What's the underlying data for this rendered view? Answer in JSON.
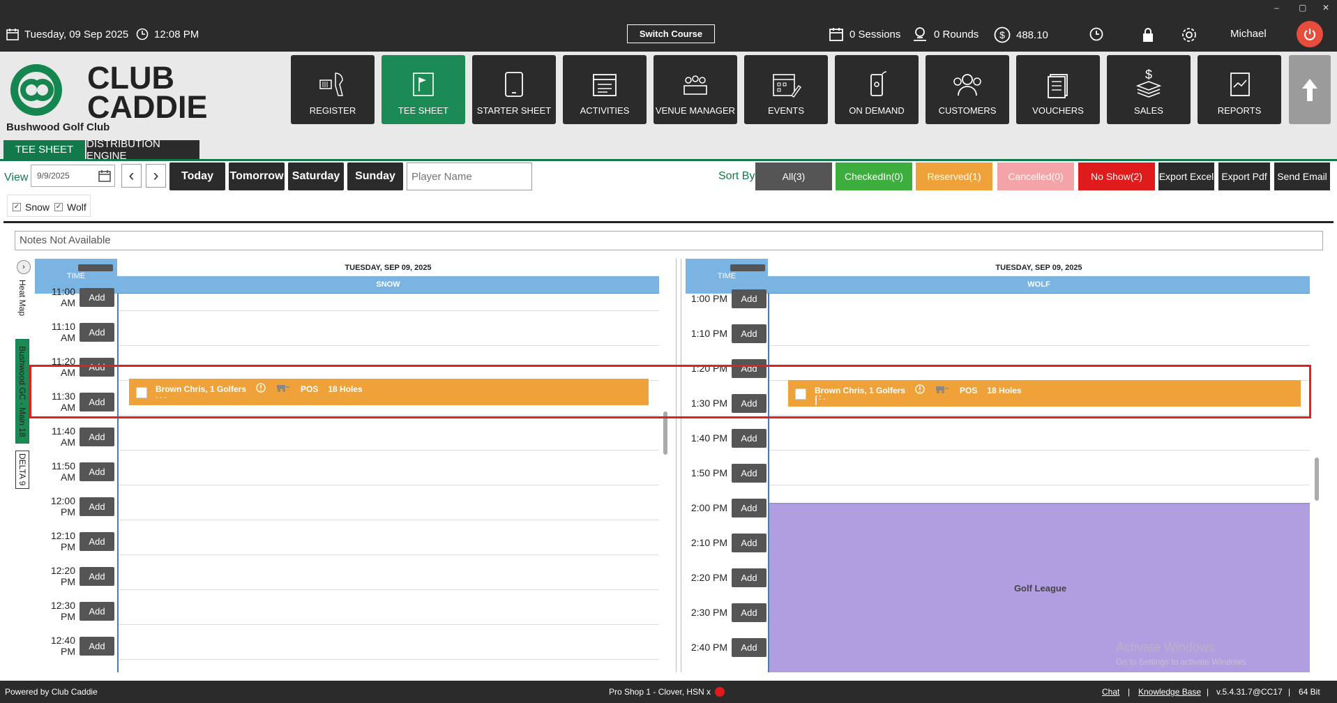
{
  "topbar": {
    "date": "Tuesday,  09 Sep 2025",
    "time": "12:08 PM",
    "switch_course": "Switch Course",
    "sessions": "0 Sessions",
    "rounds": "0 Rounds",
    "balance": "488.10",
    "user": "Michael",
    "win_controls": [
      "–",
      "▢",
      "✕"
    ]
  },
  "brand": {
    "line1": "CLUB",
    "line2": "CADDIE",
    "club_name": "Bushwood Golf Club"
  },
  "nav": [
    {
      "label": "REGISTER",
      "icon": "scanner-icon"
    },
    {
      "label": "TEE SHEET",
      "icon": "flag-icon"
    },
    {
      "label": "STARTER SHEET",
      "icon": "tablet-icon"
    },
    {
      "label": "ACTIVITIES",
      "icon": "calendar-list-icon"
    },
    {
      "label": "VENUE MANAGER",
      "icon": "venue-icon"
    },
    {
      "label": "EVENTS",
      "icon": "event-calendar-icon"
    },
    {
      "label": "ON DEMAND",
      "icon": "phone-icon"
    },
    {
      "label": "CUSTOMERS",
      "icon": "customers-icon"
    },
    {
      "label": "VOUCHERS",
      "icon": "vouchers-icon"
    },
    {
      "label": "SALES",
      "icon": "sales-icon"
    },
    {
      "label": "REPORTS",
      "icon": "reports-icon"
    }
  ],
  "subtabs": [
    "TEE SHEET",
    "DISTRIBUTION ENGINE"
  ],
  "toolbar": {
    "view_label": "View",
    "date_value": "9/9/2025",
    "prev": "‹",
    "next": "›",
    "today": "Today",
    "tomorrow": "Tomorrow",
    "saturday": "Saturday",
    "sunday": "Sunday",
    "player_placeholder": "Player Name",
    "sort_by": "Sort By",
    "sort": [
      {
        "label": "All(3)",
        "color": "#555555"
      },
      {
        "label": "CheckedIn(0)",
        "color": "#3dae3d"
      },
      {
        "label": "Reserved(1)",
        "color": "#f0a23a"
      },
      {
        "label": "Cancelled(0)",
        "color": "#f4a3a6"
      },
      {
        "label": "No Show(2)",
        "color": "#e01b1b"
      }
    ],
    "export_excel": "Export Excel",
    "export_pdf": "Export Pdf",
    "send_email": "Send Email"
  },
  "filters": [
    "Snow",
    "Wolf"
  ],
  "notes": "Notes Not Available",
  "side_tabs": {
    "heat_map": "Heat Map",
    "course_tab": "Bushwood GC - Main 18",
    "delta_tab": "DELTA 9"
  },
  "left_sheet": {
    "time_header": "TIME",
    "date": "TUESDAY, SEP 09, 2025",
    "course": "SNOW",
    "times": [
      "11:00 AM",
      "11:10 AM",
      "11:20 AM",
      "11:30 AM",
      "11:40 AM",
      "11:50 AM",
      "12:00 PM",
      "12:10 PM",
      "12:20 PM",
      "12:30 PM",
      "12:40 PM"
    ],
    "booking": {
      "name": "Brown Chris, 1 Golfers",
      "pos": "POS",
      "holes": "18 Holes",
      "sub": "- - -"
    }
  },
  "right_sheet": {
    "time_header": "TIME",
    "date": "TUESDAY, SEP 09, 2025",
    "course": "WOLF",
    "times": [
      "1:00 PM",
      "1:10 PM",
      "1:20 PM",
      "1:30 PM",
      "1:40 PM",
      "1:50 PM",
      "2:00 PM",
      "2:10 PM",
      "2:20 PM",
      "2:30 PM",
      "2:40 PM"
    ],
    "booking": {
      "name": "Brown Chris, 1 Golfers",
      "pos": "POS",
      "holes": "18 Holes",
      "sub": "- - -"
    },
    "league": "Golf League"
  },
  "add_label": "Add",
  "footer": {
    "powered": "Powered by Club Caddie",
    "station": "Pro Shop 1 - Clover, HSN x",
    "chat": "Chat",
    "kb": "Knowledge Base",
    "version": "v.5.4.31.7@CC17",
    "bits": "64 Bit",
    "sep": "|"
  },
  "watermark": {
    "line1": "Activate Windows",
    "line2": "Go to Settings to activate Windows."
  },
  "colors": {
    "accent_green": "#1c8a55",
    "dark": "#2b2b2b",
    "header_blue": "#7ab4e3",
    "booking_orange": "#f0a23a",
    "league_purple": "#b09ee0",
    "highlight_red": "#dd2222"
  }
}
